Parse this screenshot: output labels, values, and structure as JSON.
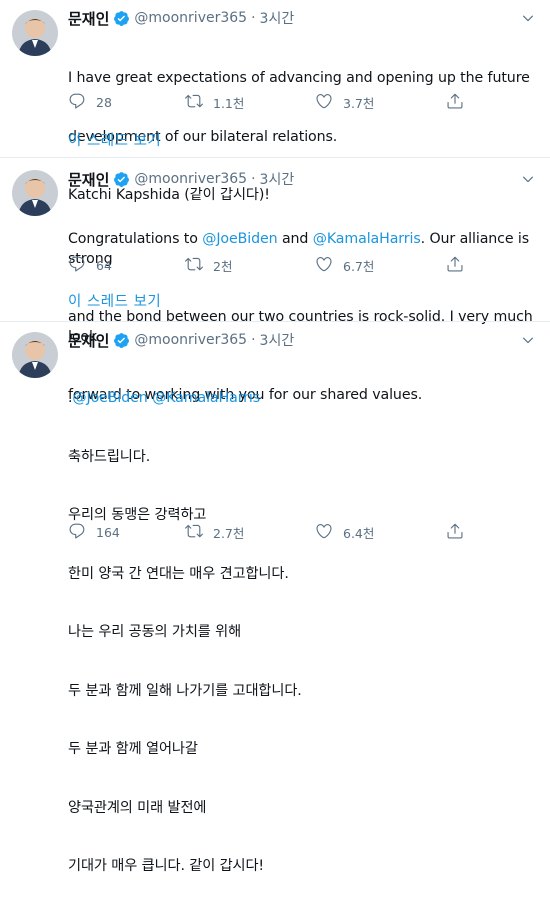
{
  "tweets": [
    {
      "name": "문재인",
      "handle": "@moonriver365",
      "separator": "·",
      "time": "3시간",
      "body": [
        {
          "text": "I have great expectations of advancing and opening up the future"
        },
        {
          "text": "development of our bilateral relations."
        },
        {
          "text": "Katchi Kapshida (같이 갑시다)!"
        }
      ],
      "reply_count": "28",
      "retweet_count": "1.1천",
      "like_count": "3.7천",
      "thread_link": "이 스레드 보기"
    },
    {
      "name": "문재인",
      "handle": "@moonriver365",
      "separator": "·",
      "time": "3시간",
      "body_mention_line": {
        "prefix": "Congratulations to ",
        "mention1": "@JoeBiden",
        "middle": " and ",
        "mention2": "@KamalaHarris",
        "suffix": ". Our alliance is strong"
      },
      "body": [
        {
          "text": "and the bond between our two countries is rock-solid. I very much look"
        },
        {
          "text": "forward to working with you for our shared values."
        }
      ],
      "reply_count": "64",
      "retweet_count": "2천",
      "like_count": "6.7천",
      "thread_link": "이 스레드 보기"
    },
    {
      "name": "문재인",
      "handle": "@moonriver365",
      "separator": "·",
      "time": "3시간",
      "mentions_line": {
        "dot": ".",
        "mention1": "@JoeBiden",
        "space": " ",
        "mention2": "@KamalaHarris"
      },
      "body": [
        {
          "text": "축하드립니다."
        },
        {
          "text": "우리의 동맹은 강력하고"
        },
        {
          "text": "한미 양국 간 연대는 매우 견고합니다."
        },
        {
          "text": "나는 우리 공동의 가치를 위해"
        },
        {
          "text": "두 분과 함께 일해 나가기를 고대합니다."
        },
        {
          "text": "두 분과 함께 열어나갈"
        },
        {
          "text": "양국관계의 미래 발전에"
        },
        {
          "text": "기대가 매우 큽니다. 같이 갑시다!"
        }
      ],
      "reply_count": "164",
      "retweet_count": "2.7천",
      "like_count": "6.4천"
    }
  ],
  "colors": {
    "link_blue": "#1b95e0",
    "muted_gray": "#5b7083",
    "verified_blue": "#1da1f2",
    "divider": "#e6ecf0"
  },
  "icons": [
    "verified-badge-icon",
    "caret-down-icon",
    "reply-icon",
    "retweet-icon",
    "like-icon",
    "share-icon"
  ]
}
